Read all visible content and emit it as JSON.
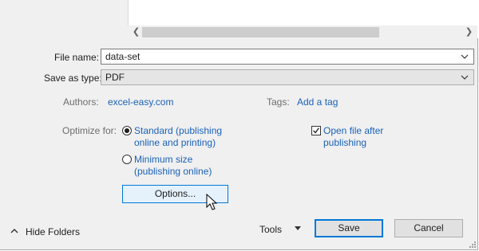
{
  "file_name": {
    "label": "File name:",
    "value": "data-set"
  },
  "save_as_type": {
    "label": "Save as type:",
    "value": "PDF"
  },
  "authors": {
    "label": "Authors:",
    "value": "excel-easy.com"
  },
  "tags": {
    "label": "Tags:",
    "value": "Add a tag"
  },
  "optimize": {
    "label": "Optimize for:",
    "standard_line1": "Standard (publishing",
    "standard_line2": "online and printing)",
    "minimum_line1": "Minimum size",
    "minimum_line2": "(publishing online)",
    "selected": "standard"
  },
  "open_after": {
    "line1": "Open file after",
    "line2": "publishing",
    "checked": true
  },
  "options_label": "Options...",
  "footer": {
    "hide_folders": "Hide Folders",
    "tools": "Tools",
    "save": "Save",
    "cancel": "Cancel"
  },
  "colors": {
    "link": "#1a62b8",
    "accent": "#0078d7"
  }
}
